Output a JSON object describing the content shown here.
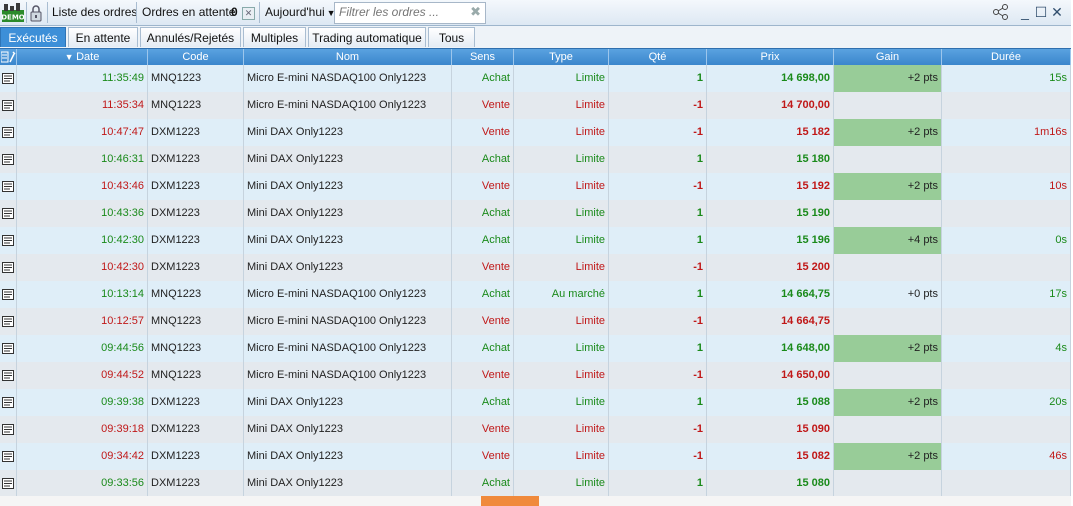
{
  "toolbar": {
    "title": "Liste des ordres",
    "pending_label": "Ordres en attente",
    "pending_count": "0",
    "period": "Aujourd'hui",
    "filter_placeholder": "Filtrer les ordres ...",
    "demo_icon": "demo-badge-icon",
    "lock_icon": "padlock-icon",
    "share_icon": "share-icon",
    "minimize_icon": "minimize-icon",
    "maximize_icon": "maximize-icon",
    "close_icon": "close-icon"
  },
  "tabs": [
    {
      "label": "Exécutés",
      "active": true
    },
    {
      "label": "En attente",
      "active": false
    },
    {
      "label": "Annulés/Rejetés",
      "active": false
    },
    {
      "label": "Multiples",
      "active": false
    },
    {
      "label": "Trading automatique",
      "active": false
    },
    {
      "label": "Tous",
      "active": false
    }
  ],
  "columns": {
    "date": "Date",
    "code": "Code",
    "name": "Nom",
    "side": "Sens",
    "type": "Type",
    "qty": "Qté",
    "price": "Prix",
    "gain": "Gain",
    "duration": "Durée"
  },
  "colors": {
    "accent": "#3d8fd8",
    "buy": "#1a8a1a",
    "sell": "#c01818",
    "gain_highlight": "#98cc98"
  },
  "rows": [
    {
      "time": "11:35:49",
      "code": "MNQ1223",
      "name": "Micro E-mini NASDAQ100 Only1223",
      "side": "Achat",
      "type": "Limite",
      "qty": "1",
      "price": "14 698,00",
      "gain": "+2 pts",
      "gain_hl": true,
      "duration": "15s"
    },
    {
      "time": "11:35:34",
      "code": "MNQ1223",
      "name": "Micro E-mini NASDAQ100 Only1223",
      "side": "Vente",
      "type": "Limite",
      "qty": "-1",
      "price": "14 700,00",
      "gain": "",
      "gain_hl": false,
      "duration": ""
    },
    {
      "time": "10:47:47",
      "code": "DXM1223",
      "name": "Mini DAX Only1223",
      "side": "Vente",
      "type": "Limite",
      "qty": "-1",
      "price": "15 182",
      "gain": "+2 pts",
      "gain_hl": true,
      "duration": "1m16s"
    },
    {
      "time": "10:46:31",
      "code": "DXM1223",
      "name": "Mini DAX Only1223",
      "side": "Achat",
      "type": "Limite",
      "qty": "1",
      "price": "15 180",
      "gain": "",
      "gain_hl": false,
      "duration": ""
    },
    {
      "time": "10:43:46",
      "code": "DXM1223",
      "name": "Mini DAX Only1223",
      "side": "Vente",
      "type": "Limite",
      "qty": "-1",
      "price": "15 192",
      "gain": "+2 pts",
      "gain_hl": true,
      "duration": "10s"
    },
    {
      "time": "10:43:36",
      "code": "DXM1223",
      "name": "Mini DAX Only1223",
      "side": "Achat",
      "type": "Limite",
      "qty": "1",
      "price": "15 190",
      "gain": "",
      "gain_hl": false,
      "duration": ""
    },
    {
      "time": "10:42:30",
      "code": "DXM1223",
      "name": "Mini DAX Only1223",
      "side": "Achat",
      "type": "Limite",
      "qty": "1",
      "price": "15 196",
      "gain": "+4 pts",
      "gain_hl": true,
      "duration": "0s"
    },
    {
      "time": "10:42:30",
      "code": "DXM1223",
      "name": "Mini DAX Only1223",
      "side": "Vente",
      "type": "Limite",
      "qty": "-1",
      "price": "15 200",
      "gain": "",
      "gain_hl": false,
      "duration": ""
    },
    {
      "time": "10:13:14",
      "code": "MNQ1223",
      "name": "Micro E-mini NASDAQ100 Only1223",
      "side": "Achat",
      "type": "Au marché",
      "qty": "1",
      "price": "14 664,75",
      "gain": "+0 pts",
      "gain_hl": false,
      "duration": "17s"
    },
    {
      "time": "10:12:57",
      "code": "MNQ1223",
      "name": "Micro E-mini NASDAQ100 Only1223",
      "side": "Vente",
      "type": "Limite",
      "qty": "-1",
      "price": "14 664,75",
      "gain": "",
      "gain_hl": false,
      "duration": ""
    },
    {
      "time": "09:44:56",
      "code": "MNQ1223",
      "name": "Micro E-mini NASDAQ100 Only1223",
      "side": "Achat",
      "type": "Limite",
      "qty": "1",
      "price": "14 648,00",
      "gain": "+2 pts",
      "gain_hl": true,
      "duration": "4s"
    },
    {
      "time": "09:44:52",
      "code": "MNQ1223",
      "name": "Micro E-mini NASDAQ100 Only1223",
      "side": "Vente",
      "type": "Limite",
      "qty": "-1",
      "price": "14 650,00",
      "gain": "",
      "gain_hl": false,
      "duration": ""
    },
    {
      "time": "09:39:38",
      "code": "DXM1223",
      "name": "Mini DAX Only1223",
      "side": "Achat",
      "type": "Limite",
      "qty": "1",
      "price": "15 088",
      "gain": "+2 pts",
      "gain_hl": true,
      "duration": "20s"
    },
    {
      "time": "09:39:18",
      "code": "DXM1223",
      "name": "Mini DAX Only1223",
      "side": "Vente",
      "type": "Limite",
      "qty": "-1",
      "price": "15 090",
      "gain": "",
      "gain_hl": false,
      "duration": ""
    },
    {
      "time": "09:34:42",
      "code": "DXM1223",
      "name": "Mini DAX Only1223",
      "side": "Vente",
      "type": "Limite",
      "qty": "-1",
      "price": "15 082",
      "gain": "+2 pts",
      "gain_hl": true,
      "duration": "46s"
    },
    {
      "time": "09:33:56",
      "code": "DXM1223",
      "name": "Mini DAX Only1223",
      "side": "Achat",
      "type": "Limite",
      "qty": "1",
      "price": "15 080",
      "gain": "",
      "gain_hl": false,
      "duration": ""
    }
  ]
}
